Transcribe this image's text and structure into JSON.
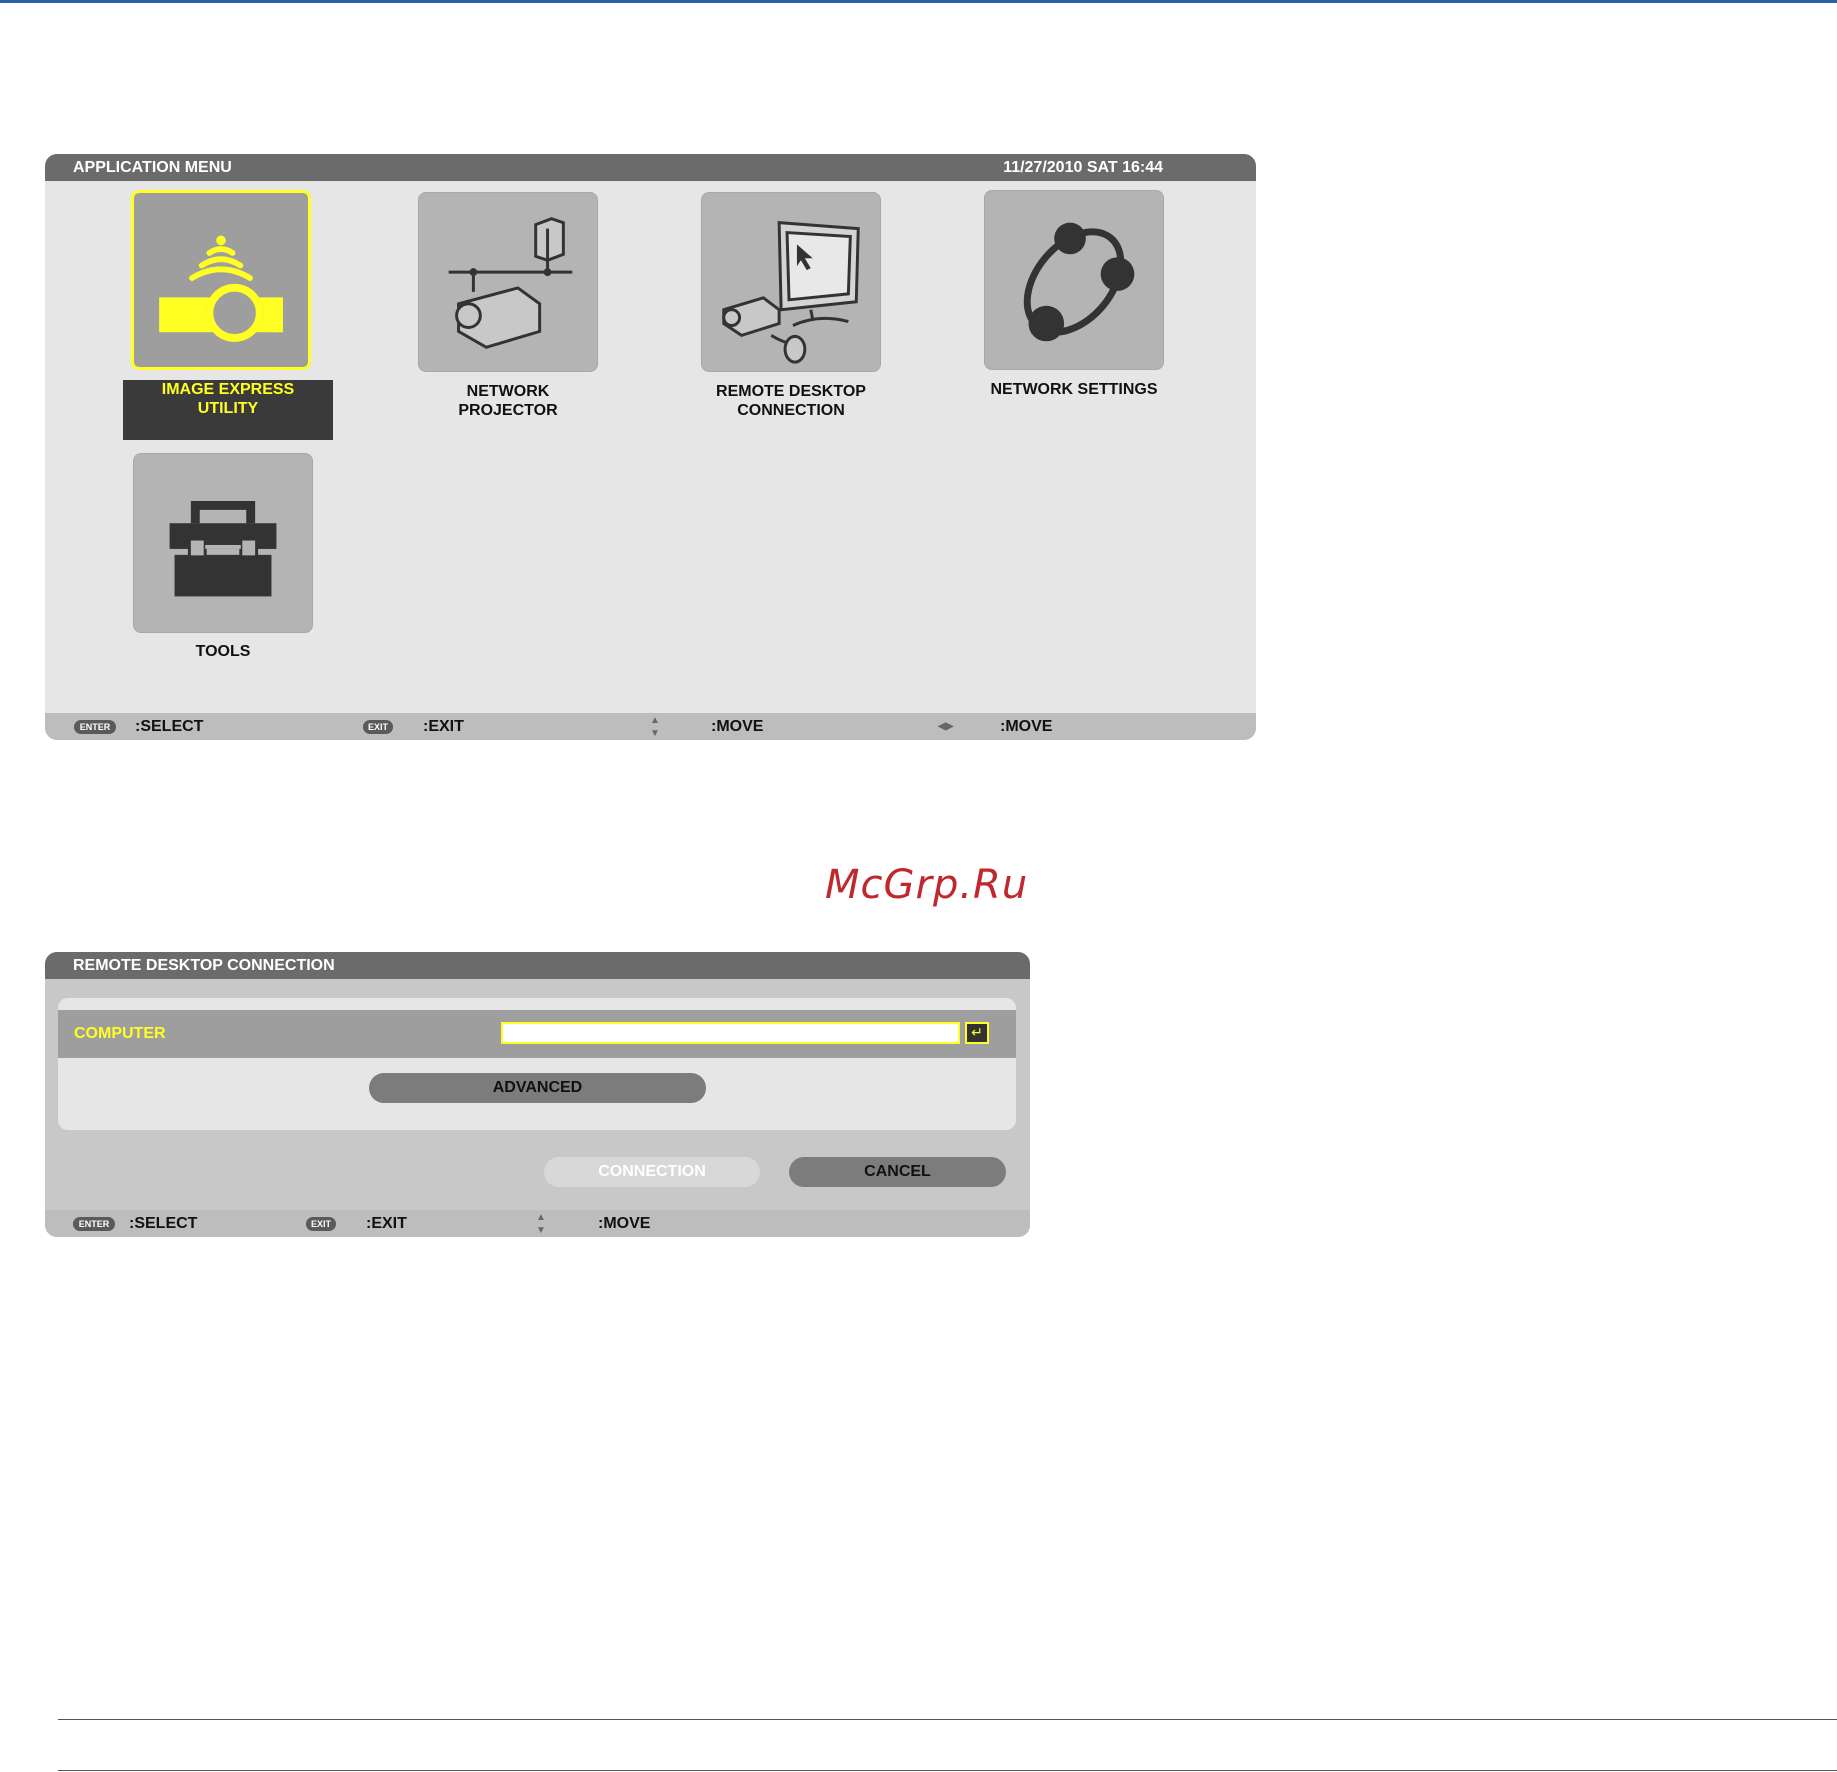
{
  "app_menu": {
    "title": "APPLICATION MENU",
    "datetime": "11/27/2010 SAT 16:44",
    "items": [
      {
        "label_line1": "IMAGE EXPRESS",
        "label_line2": "UTILITY",
        "selected": true
      },
      {
        "label_line1": "NETWORK",
        "label_line2": "PROJECTOR",
        "selected": false
      },
      {
        "label_line1": "REMOTE DESKTOP",
        "label_line2": "CONNECTION",
        "selected": false
      },
      {
        "label_line1": "NETWORK SETTINGS",
        "label_line2": "",
        "selected": false
      },
      {
        "label_line1": "TOOLS",
        "label_line2": "",
        "selected": false
      }
    ],
    "footer": {
      "enter_key": "ENTER",
      "select": ":SELECT",
      "exit_key": "EXIT",
      "exit": ":EXIT",
      "updown_move": ":MOVE",
      "leftright_move": ":MOVE"
    }
  },
  "watermark": "McGrp.Ru",
  "remote_desktop": {
    "title": "REMOTE DESKTOP CONNECTION",
    "computer_label": "COMPUTER",
    "computer_value": "",
    "advanced_label": "ADVANCED",
    "connection_label": "CONNECTION",
    "cancel_label": "CANCEL",
    "footer": {
      "enter_key": "ENTER",
      "select": ":SELECT",
      "exit_key": "EXIT",
      "exit": ":EXIT",
      "updown_move": ":MOVE"
    }
  },
  "colors": {
    "highlight": "#ffff22",
    "titlebar": "#6b6b6b",
    "watermark": "#c0282d"
  }
}
